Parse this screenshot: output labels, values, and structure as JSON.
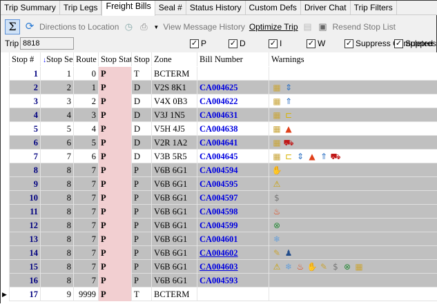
{
  "tabs": [
    "Trip Summary",
    "Trip Legs",
    "Freight Bills",
    "Seal #",
    "Status History",
    "Custom Defs",
    "Driver Chat",
    "Trip Filters"
  ],
  "active_tab": "Freight Bills",
  "toolbar": {
    "directions": "Directions to Location",
    "view_history": "View Message History",
    "optimize": "Optimize Trip",
    "resend": "Resend Stop List"
  },
  "trip": {
    "label": "Trip",
    "value": "8818"
  },
  "filters": [
    {
      "label": "P",
      "checked": true
    },
    {
      "label": "D",
      "checked": true
    },
    {
      "label": "I",
      "checked": true
    },
    {
      "label": "W",
      "checked": true
    },
    {
      "label": "Suppress Completed",
      "checked": true
    },
    {
      "label": "Suppress",
      "checked": true
    }
  ],
  "columns": [
    "Stop #",
    "Stop Se",
    "Route",
    "Stop Stat",
    "Stop",
    "Zone",
    "Bill Number",
    "Warnings"
  ],
  "rows": [
    {
      "stop": "1",
      "seq": "1",
      "route": "0",
      "stat": "P",
      "type": "T",
      "zone": "BCTERM",
      "bill": "",
      "warnings": []
    },
    {
      "stop": "2",
      "seq": "2",
      "route": "1",
      "stat": "P",
      "type": "D",
      "zone": "V2S 8K1",
      "bill": "CA004625",
      "warnings": [
        "freight-icon",
        "up-down-arrow-icon"
      ]
    },
    {
      "stop": "3",
      "seq": "3",
      "route": "2",
      "stat": "P",
      "type": "D",
      "zone": "V4X 0B3",
      "bill": "CA004622",
      "warnings": [
        "freight-icon",
        "stacking-arrow-icon"
      ]
    },
    {
      "stop": "4",
      "seq": "4",
      "route": "3",
      "stat": "P",
      "type": "D",
      "zone": "V3J 1N5",
      "bill": "CA004631",
      "warnings": [
        "freight-icon",
        "hand-truck-icon"
      ]
    },
    {
      "stop": "5",
      "seq": "5",
      "route": "4",
      "stat": "P",
      "type": "D",
      "zone": "V5H 4J5",
      "bill": "CA004638",
      "warnings": [
        "freight-icon",
        "traffic-cone-icon"
      ]
    },
    {
      "stop": "6",
      "seq": "6",
      "route": "5",
      "stat": "P",
      "type": "D",
      "zone": "V2R 1A2",
      "bill": "CA004641",
      "warnings": [
        "freight-icon",
        "truck-icon"
      ]
    },
    {
      "stop": "7",
      "seq": "7",
      "route": "6",
      "stat": "P",
      "type": "D",
      "zone": "V3B 5R5",
      "bill": "CA004645",
      "warnings": [
        "freight-icon",
        "hand-truck-icon",
        "up-down-arrow-icon",
        "traffic-cone-icon",
        "stacking-arrow-icon",
        "truck-icon"
      ]
    },
    {
      "stop": "8",
      "seq": "8",
      "route": "7",
      "stat": "P",
      "type": "P",
      "zone": "V6B 6G1",
      "bill": "CA004594",
      "warnings": [
        "hand-icon"
      ]
    },
    {
      "stop": "9",
      "seq": "8",
      "route": "7",
      "stat": "P",
      "type": "P",
      "zone": "V6B 6G1",
      "bill": "CA004595",
      "warnings": [
        "warning-icon"
      ]
    },
    {
      "stop": "10",
      "seq": "8",
      "route": "7",
      "stat": "P",
      "type": "P",
      "zone": "V6B 6G1",
      "bill": "CA004597",
      "warnings": [
        "dollar-icon"
      ]
    },
    {
      "stop": "11",
      "seq": "8",
      "route": "7",
      "stat": "P",
      "type": "P",
      "zone": "V6B 6G1",
      "bill": "CA004598",
      "warnings": [
        "fire-icon"
      ]
    },
    {
      "stop": "12",
      "seq": "8",
      "route": "7",
      "stat": "P",
      "type": "P",
      "zone": "V6B 6G1",
      "bill": "CA004599",
      "warnings": [
        "globe-x-icon"
      ]
    },
    {
      "stop": "13",
      "seq": "8",
      "route": "7",
      "stat": "P",
      "type": "P",
      "zone": "V6B 6G1",
      "bill": "CA004601",
      "warnings": [
        "snowflake-icon"
      ]
    },
    {
      "stop": "14",
      "seq": "8",
      "route": "7",
      "stat": "P",
      "type": "P",
      "zone": "V6B 6G1",
      "bill": "CA004602",
      "warnings": [
        "note-icon",
        "person-icon"
      ]
    },
    {
      "stop": "15",
      "seq": "8",
      "route": "7",
      "stat": "P",
      "type": "P",
      "zone": "V6B 6G1",
      "bill": "CA004603",
      "warnings": [
        "warning-icon",
        "snowflake-icon",
        "fire-icon",
        "hand-icon",
        "note-icon",
        "dollar-icon",
        "globe-x-icon",
        "freight-icon"
      ]
    },
    {
      "stop": "16",
      "seq": "8",
      "route": "7",
      "stat": "P",
      "type": "P",
      "zone": "V6B 6G1",
      "bill": "CA004593",
      "warnings": []
    },
    {
      "stop": "17",
      "seq": "9",
      "route": "9999",
      "stat": "P",
      "type": "T",
      "zone": "BCTERM",
      "bill": "",
      "warnings": []
    }
  ],
  "gray_rows": [
    2,
    4,
    6,
    8,
    9,
    10,
    11,
    12,
    13,
    14,
    15,
    16
  ],
  "underlined_bills": [
    "CA004602",
    "CA004603"
  ],
  "current_row": 17,
  "colors": {
    "row_gray": "#c0c0c0",
    "status_pink": "#f2cfd1",
    "bill_blue": "#0000e0",
    "stop_num": "#000080"
  }
}
